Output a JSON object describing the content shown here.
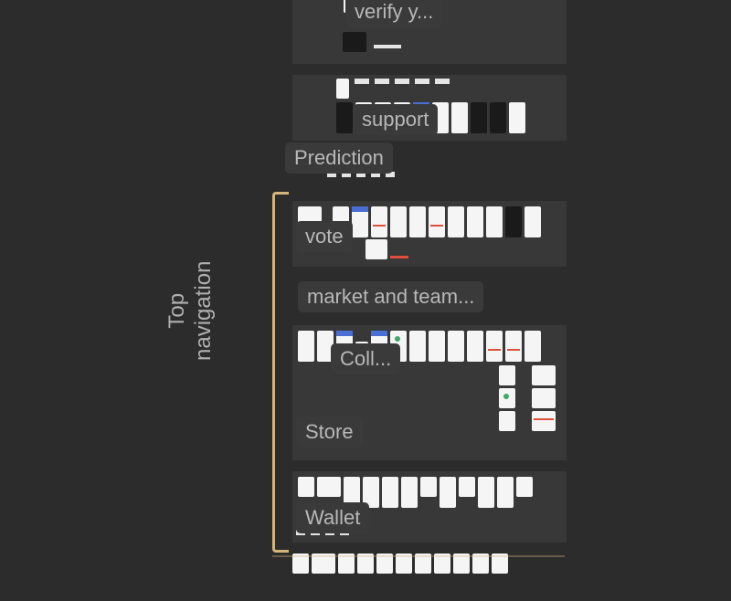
{
  "section": {
    "label_line1": "Top",
    "label_line2": "navigation"
  },
  "groups": {
    "verify": {
      "label": "verify y..."
    },
    "support": {
      "label": "support"
    },
    "prediction": {
      "label": "Prediction"
    },
    "vote": {
      "label": "vote"
    },
    "market": {
      "label": "market and team..."
    },
    "coll": {
      "label": "Coll..."
    },
    "store": {
      "label": "Store"
    },
    "wallet": {
      "label": "Wallet"
    }
  },
  "colors": {
    "bracket": "#D4B47A",
    "canvas_bg": "#2C2C2C",
    "label_bg": "#3A3A3A",
    "label_text": "#B8B8B8"
  }
}
